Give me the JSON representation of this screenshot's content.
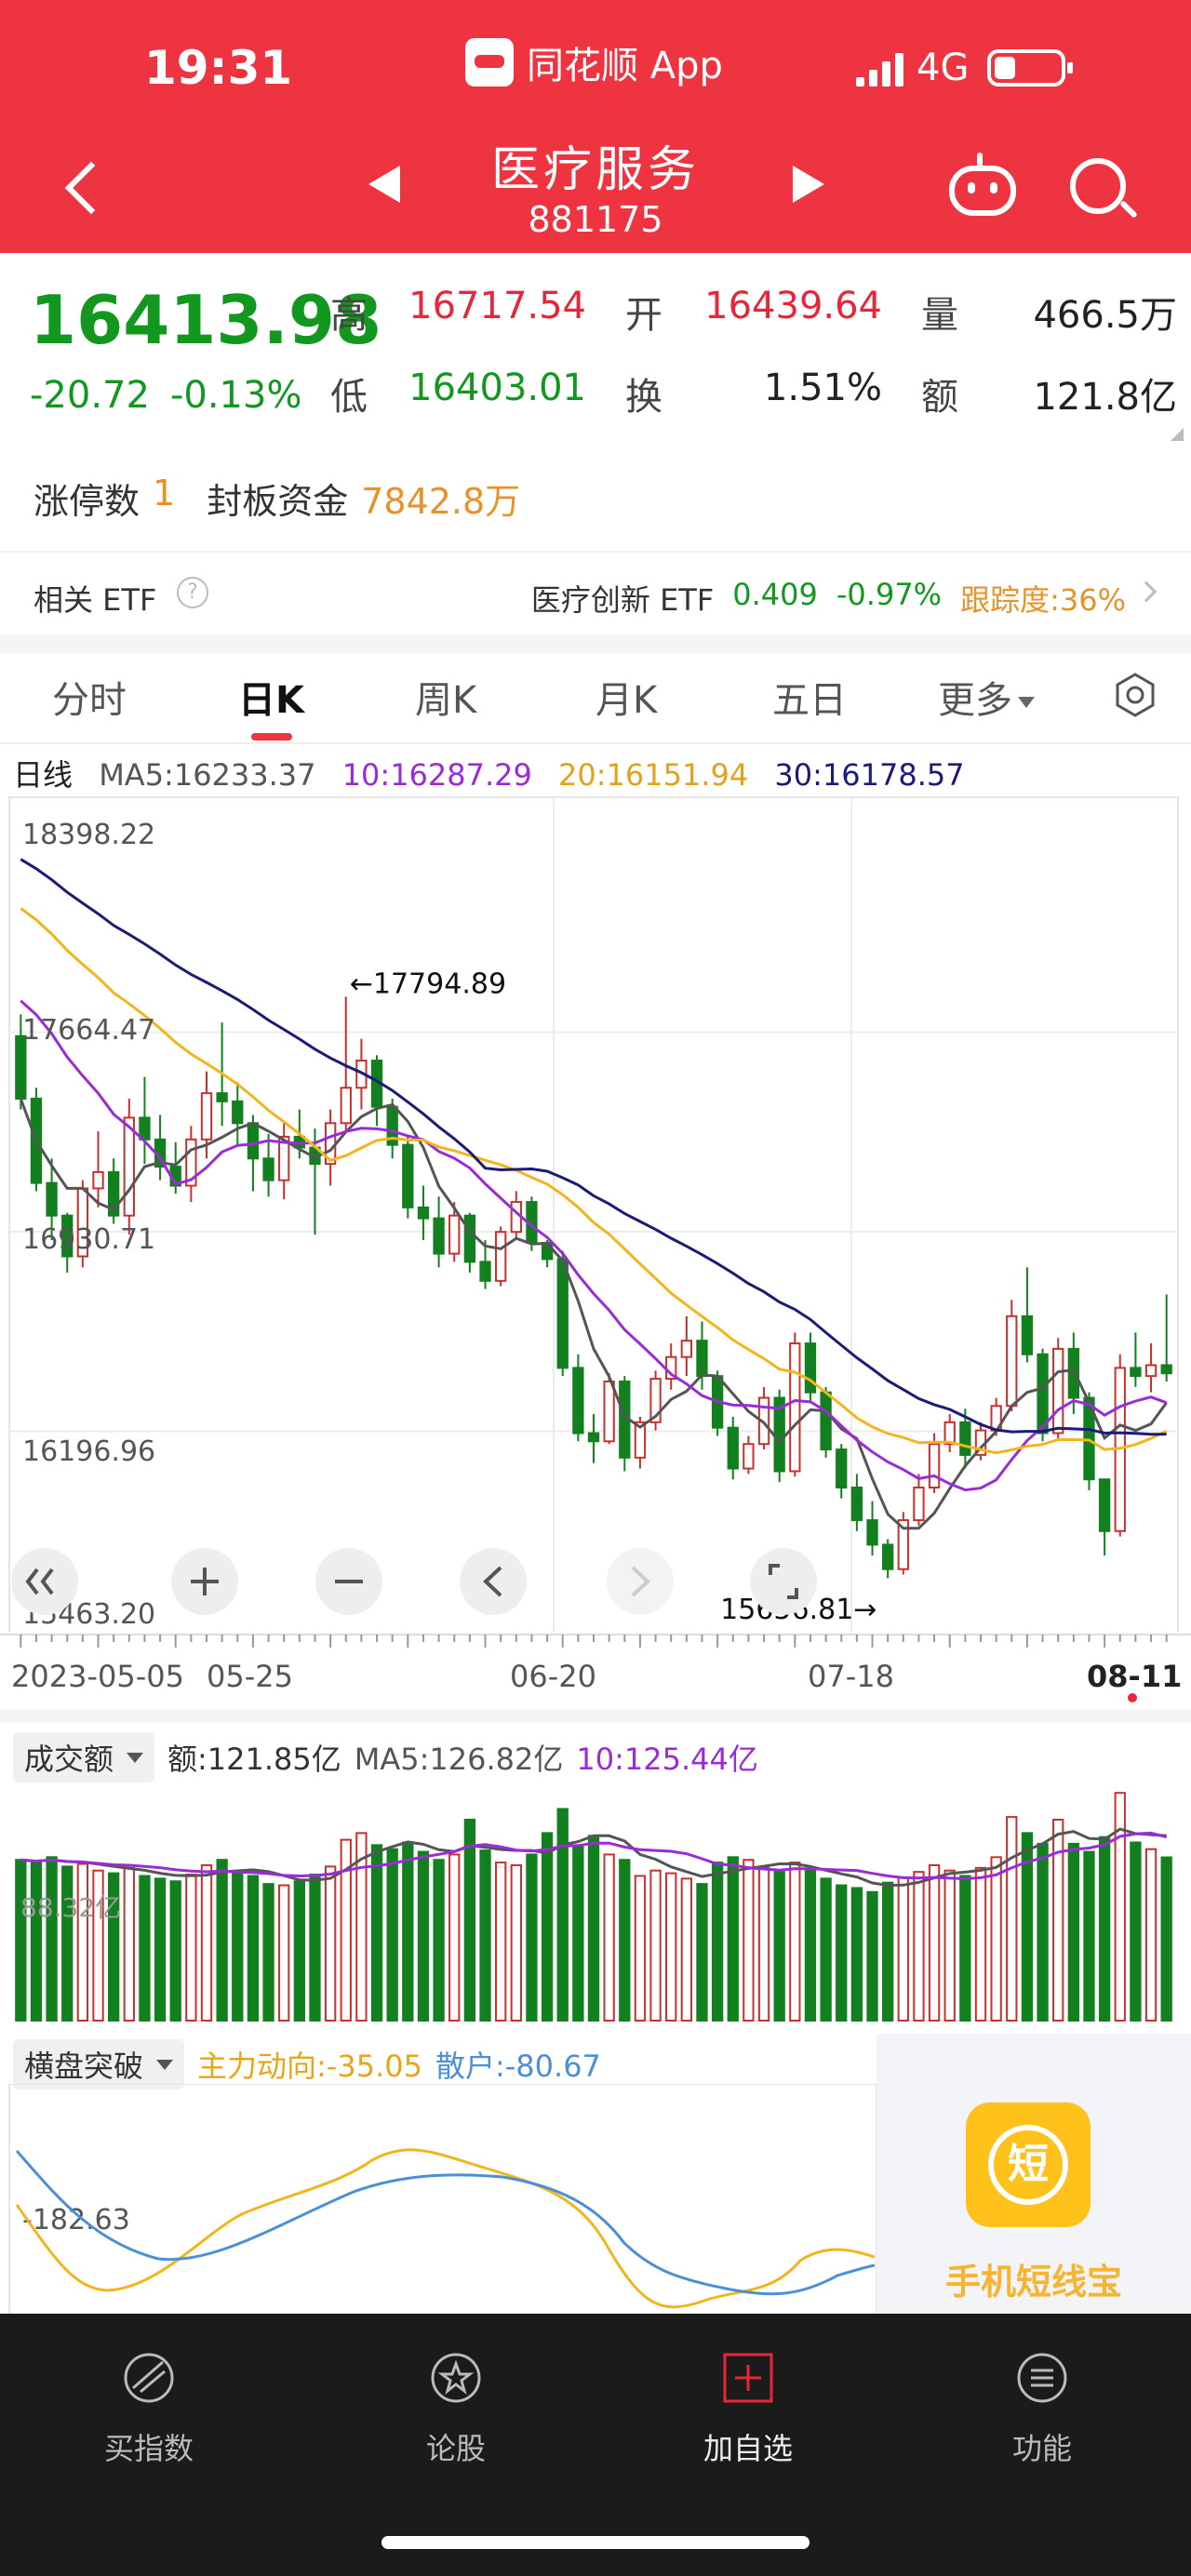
{
  "status_bar": {
    "time": "19:31",
    "app_name": "同花顺 App",
    "network": "4G"
  },
  "header": {
    "stock_name": "医疗服务",
    "stock_code": "881175"
  },
  "quote": {
    "price": "16413.98",
    "change": "-20.72",
    "change_pct": "-0.13%",
    "high_label": "高",
    "high": "16717.54",
    "open_label": "开",
    "open": "16439.64",
    "volume_label": "量",
    "volume": "466.5万",
    "low_label": "低",
    "low": "16403.01",
    "turnover_label": "换",
    "turnover": "1.51%",
    "amount_label": "额",
    "amount": "121.8亿",
    "limit_up_label": "涨停数",
    "limit_up": "1",
    "seal_label": "封板资金",
    "seal_amount": "7842.8万"
  },
  "etf": {
    "label": "相关 ETF",
    "help": "?",
    "name": "医疗创新 ETF",
    "price": "0.409",
    "change_pct": "-0.97%",
    "tracking": "跟踪度:36%"
  },
  "tabs": [
    "分时",
    "日K",
    "周K",
    "月K",
    "五日",
    "更多"
  ],
  "ma_legend": {
    "kind": "日线",
    "ma5": "MA5:16233.37",
    "ma10": "10:16287.29",
    "ma20": "20:16151.94",
    "ma30": "30:16178.57"
  },
  "kline": {
    "y_max": 18398.22,
    "y_min": 15463.2,
    "axis_labels": [
      "18398.22",
      "17664.47",
      "16930.71",
      "16196.96",
      "15463.20"
    ],
    "max_marker": "←17794.89",
    "min_marker": "15656.81→",
    "dates": [
      "2023-05-05",
      "05-25",
      "06-20",
      "07-18",
      "08-11"
    ],
    "colors": {
      "up": "#c9302c",
      "down": "#13801f",
      "ma5": "#555555",
      "ma10": "#9a2bd6",
      "ma20": "#f2b51c",
      "ma30": "#1b1b78"
    },
    "candles": [
      [
        17650,
        17730,
        17380,
        17420
      ],
      [
        17420,
        17460,
        17080,
        17110
      ],
      [
        17110,
        17200,
        16900,
        16990
      ],
      [
        16990,
        17000,
        16780,
        16840
      ],
      [
        16840,
        17120,
        16800,
        17090
      ],
      [
        17090,
        17300,
        17020,
        17150
      ],
      [
        17150,
        17200,
        16960,
        16990
      ],
      [
        16990,
        17420,
        16920,
        17350
      ],
      [
        17350,
        17500,
        17180,
        17270
      ],
      [
        17270,
        17360,
        17120,
        17170
      ],
      [
        17170,
        17260,
        17070,
        17100
      ],
      [
        17100,
        17320,
        17040,
        17270
      ],
      [
        17270,
        17520,
        17200,
        17440
      ],
      [
        17440,
        17700,
        17320,
        17410
      ],
      [
        17410,
        17480,
        17250,
        17330
      ],
      [
        17330,
        17360,
        17080,
        17200
      ],
      [
        17200,
        17290,
        17060,
        17120
      ],
      [
        17120,
        17330,
        17050,
        17280
      ],
      [
        17280,
        17380,
        17200,
        17240
      ],
      [
        17240,
        17310,
        16920,
        17180
      ],
      [
        17180,
        17380,
        17100,
        17330
      ],
      [
        17330,
        17794.89,
        17300,
        17460
      ],
      [
        17460,
        17640,
        17380,
        17560
      ],
      [
        17560,
        17580,
        17320,
        17390
      ],
      [
        17390,
        17420,
        17200,
        17250
      ],
      [
        17250,
        17280,
        16980,
        17020
      ],
      [
        17020,
        17100,
        16900,
        16980
      ],
      [
        16980,
        17060,
        16800,
        16850
      ],
      [
        16850,
        17040,
        16820,
        16990
      ],
      [
        16990,
        17000,
        16780,
        16820
      ],
      [
        16820,
        16900,
        16720,
        16750
      ],
      [
        16750,
        16950,
        16730,
        16930
      ],
      [
        16930,
        17080,
        16900,
        17040
      ],
      [
        17040,
        17060,
        16860,
        16890
      ],
      [
        16890,
        16900,
        16800,
        16830
      ],
      [
        16830,
        16860,
        16400,
        16430
      ],
      [
        16430,
        16480,
        16160,
        16190
      ],
      [
        16190,
        16260,
        16080,
        16160
      ],
      [
        16160,
        16410,
        16150,
        16380
      ],
      [
        16380,
        16400,
        16050,
        16100
      ],
      [
        16100,
        16250,
        16060,
        16230
      ],
      [
        16230,
        16420,
        16200,
        16390
      ],
      [
        16390,
        16520,
        16350,
        16470
      ],
      [
        16470,
        16620,
        16400,
        16530
      ],
      [
        16530,
        16600,
        16350,
        16400
      ],
      [
        16400,
        16420,
        16180,
        16210
      ],
      [
        16210,
        16250,
        16020,
        16060
      ],
      [
        16060,
        16180,
        16040,
        16150
      ],
      [
        16150,
        16360,
        16130,
        16320
      ],
      [
        16320,
        16350,
        16010,
        16050
      ],
      [
        16050,
        16560,
        16030,
        16520
      ],
      [
        16520,
        16560,
        16300,
        16340
      ],
      [
        16340,
        16360,
        16100,
        16130
      ],
      [
        16130,
        16150,
        15950,
        15990
      ],
      [
        15990,
        16040,
        15830,
        15870
      ],
      [
        15870,
        15940,
        15740,
        15780
      ],
      [
        15780,
        15800,
        15656.81,
        15690
      ],
      [
        15690,
        15900,
        15670,
        15870
      ],
      [
        15870,
        16040,
        15850,
        15990
      ],
      [
        15990,
        16190,
        15970,
        16150
      ],
      [
        16150,
        16260,
        16120,
        16230
      ],
      [
        16230,
        16280,
        16060,
        16110
      ],
      [
        16110,
        16230,
        16090,
        16200
      ],
      [
        16200,
        16320,
        16180,
        16290
      ],
      [
        16290,
        16680,
        16270,
        16620
      ],
      [
        16620,
        16800,
        16450,
        16480
      ],
      [
        16480,
        16500,
        16160,
        16190
      ],
      [
        16190,
        16540,
        16170,
        16500
      ],
      [
        16500,
        16560,
        16260,
        16320
      ],
      [
        16320,
        16340,
        15980,
        16020
      ],
      [
        16020,
        15990,
        15740,
        15830
      ],
      [
        15830,
        16480,
        15810,
        16430
      ],
      [
        16430,
        16560,
        16360,
        16400
      ],
      [
        16400,
        16520,
        16340,
        16440
      ],
      [
        16440,
        16700,
        16380,
        16410
      ]
    ]
  },
  "volume": {
    "dropdown": "成交额",
    "amount": "额:121.85亿",
    "ma5": "MA5:126.82亿",
    "ma10": "10:125.44亿",
    "axis_label": "88.32亿",
    "values": [
      120,
      118,
      122,
      115,
      117,
      112,
      110,
      114,
      108,
      106,
      104,
      109,
      116,
      120,
      110,
      108,
      102,
      101,
      104,
      109,
      115,
      135,
      140,
      131,
      128,
      133,
      126,
      120,
      124,
      150,
      127,
      118,
      116,
      124,
      140,
      158,
      130,
      138,
      124,
      120,
      108,
      112,
      110,
      106,
      102,
      118,
      122,
      120,
      114,
      111,
      118,
      112,
      106,
      101,
      99,
      96,
      103,
      107,
      111,
      116,
      112,
      108,
      114,
      122,
      152,
      140,
      132,
      150,
      132,
      126,
      137,
      170,
      133,
      128,
      121.85
    ]
  },
  "indicator": {
    "dropdown": "横盘突破",
    "main_force": "主力动向:-35.05",
    "retail": "散户:-80.67",
    "axis_label": "-182.63",
    "colors": {
      "main_force": "#f2b51c",
      "retail": "#4a90d9"
    }
  },
  "ad": {
    "text": "手机短线宝",
    "icon_char": "短"
  },
  "bottom_nav": [
    "买指数",
    "论股",
    "加自选",
    "功能"
  ]
}
